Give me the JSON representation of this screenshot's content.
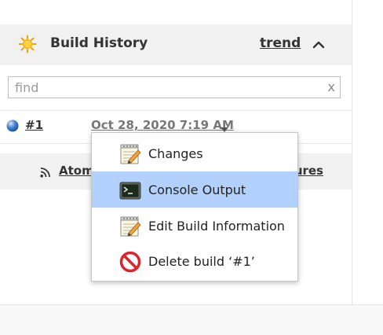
{
  "build_history": {
    "title": "Build History",
    "trend_label": "trend",
    "icon": "sun-icon",
    "collapse_icon": "chevron-up-icon"
  },
  "search": {
    "placeholder": "find",
    "value": "",
    "clear_label": "x"
  },
  "build": {
    "number": "#1",
    "date": "Oct 28, 2020 7:19 AM",
    "status_icon": "blue-ball-icon"
  },
  "feeds": {
    "atom_label": "Atom",
    "failures_label": "ures"
  },
  "context_menu": {
    "items": [
      {
        "label": "Changes",
        "icon": "notepad-icon",
        "active": false
      },
      {
        "label": "Console Output",
        "icon": "terminal-icon",
        "active": true
      },
      {
        "label": "Edit Build Information",
        "icon": "notepad-icon",
        "active": false
      },
      {
        "label": "Delete build ‘#1’",
        "icon": "no-entry-icon",
        "active": false
      }
    ]
  },
  "colors": {
    "panel_bg": "#f1f1f1",
    "highlight": "#b3d1ff",
    "link_text": "#333333"
  }
}
